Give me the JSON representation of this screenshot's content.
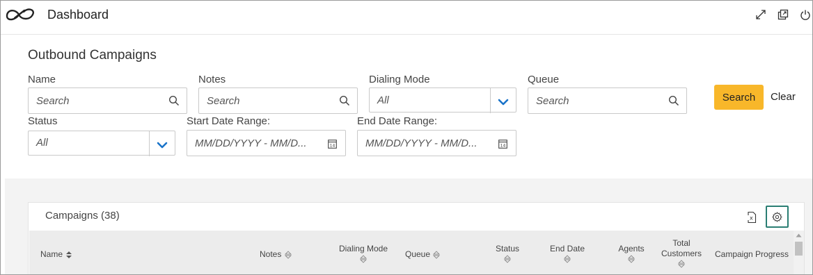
{
  "header": {
    "title": "Dashboard",
    "icons": [
      "logo-icon",
      "expand-icon",
      "popout-icon",
      "power-icon"
    ]
  },
  "page": {
    "title": "Outbound Campaigns"
  },
  "filters": {
    "name": {
      "label": "Name",
      "placeholder": "Search"
    },
    "notes": {
      "label": "Notes",
      "placeholder": "Search"
    },
    "dialing_mode": {
      "label": "Dialing Mode",
      "value": "All"
    },
    "queue": {
      "label": "Queue",
      "placeholder": "Search"
    },
    "status": {
      "label": "Status",
      "value": "All"
    },
    "start_date": {
      "label": "Start Date Range:",
      "placeholder": "MM/DD/YYYY - MM/D..."
    },
    "end_date": {
      "label": "End Date Range:",
      "placeholder": "MM/DD/YYYY - MM/D..."
    },
    "search_label": "Search",
    "clear_label": "Clear"
  },
  "campaigns": {
    "title": "Campaigns (38)",
    "columns": {
      "name": "Name",
      "notes": "Notes",
      "dialing_mode": "Dialing Mode",
      "queue": "Queue",
      "status": "Status",
      "end_date": "End Date",
      "agents": "Agents",
      "total_customers_1": "Total",
      "total_customers_2": "Customers",
      "campaign_progress": "Campaign Progress"
    }
  },
  "colors": {
    "accent": "#f8b72a",
    "link_blue": "#1a73c9",
    "settings_border": "#2a7e73"
  }
}
